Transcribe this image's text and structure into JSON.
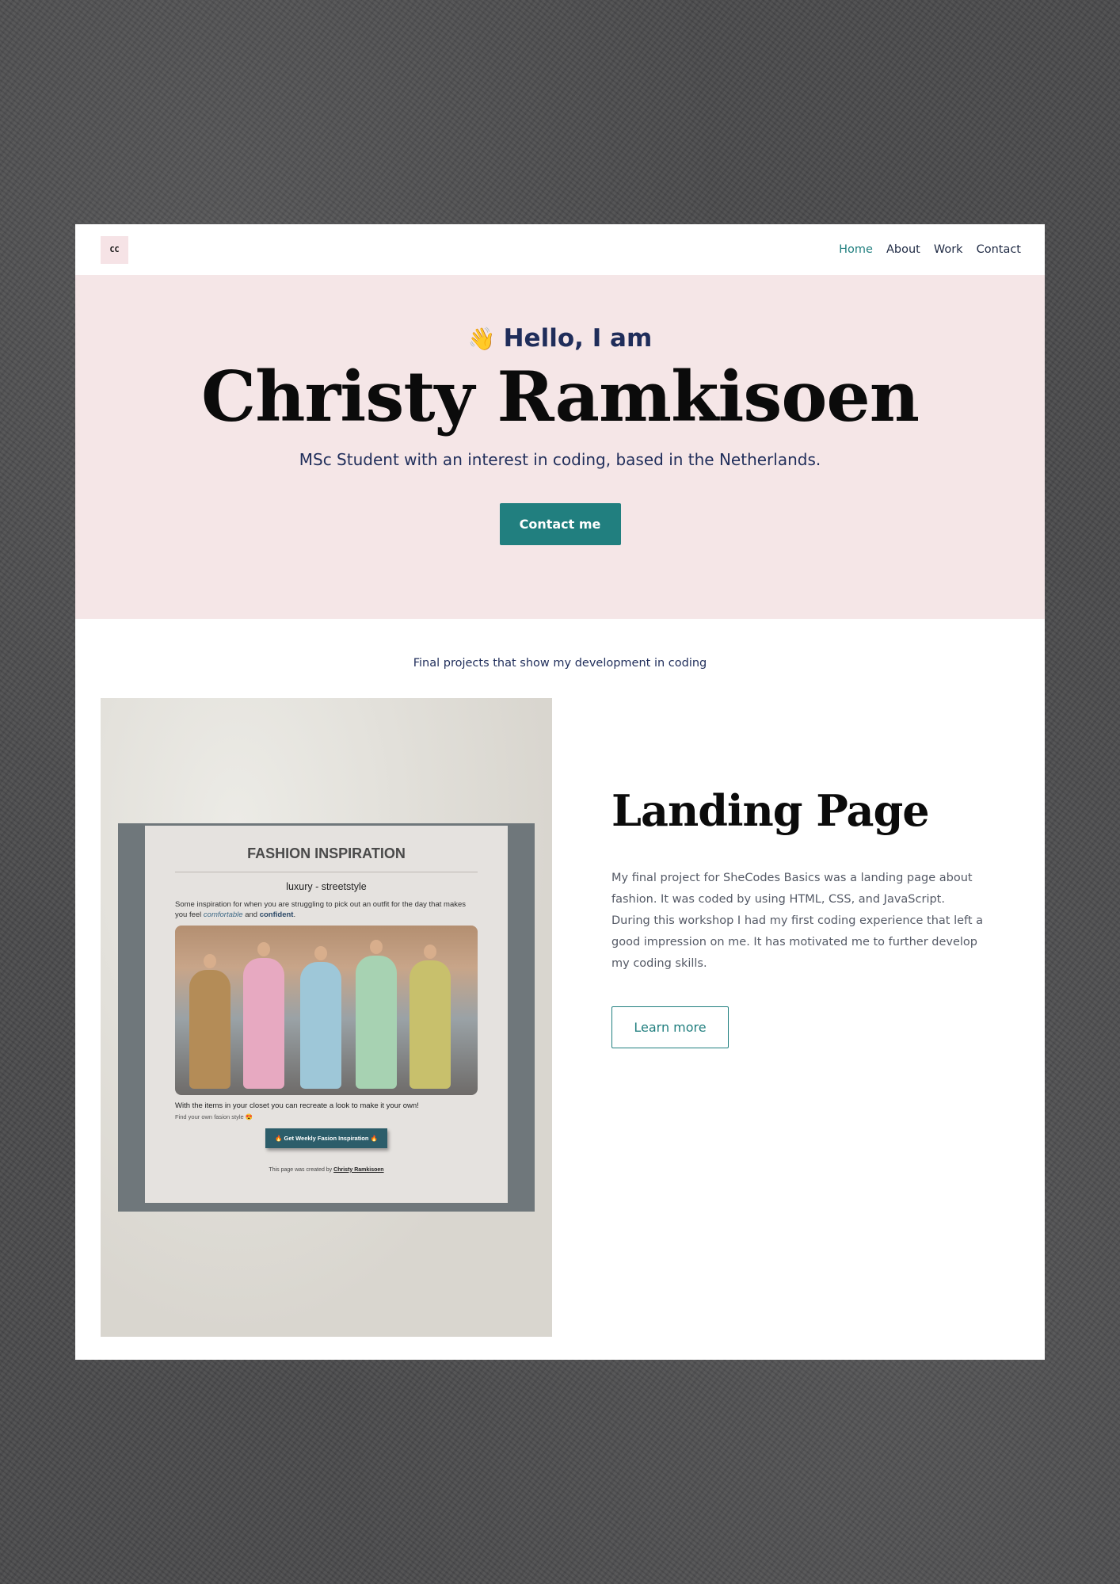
{
  "nav": {
    "logo": "CC",
    "links": [
      {
        "label": "Home",
        "active": true
      },
      {
        "label": "About",
        "active": false
      },
      {
        "label": "Work",
        "active": false
      },
      {
        "label": "Contact",
        "active": false
      }
    ]
  },
  "hero": {
    "wave_emoji": "👋",
    "greeting": "Hello, I am",
    "name": "Christy Ramkisoen",
    "tagline": "MSc Student with an interest in coding, based in the Netherlands.",
    "cta": "Contact me"
  },
  "projects": {
    "intro": "Final projects that show my development in coding",
    "items": [
      {
        "title": "Landing Page",
        "description": "My final project for SheCodes Basics was a landing page about fashion. It was coded by using HTML, CSS, and JavaScript. During this workshop I had my first coding experience that left a good impression on me. It has motivated me to further develop my coding skills.",
        "button": "Learn more",
        "preview": {
          "title": "FASHION INSPIRATION",
          "subtitle": "luxury - streetstyle",
          "text_start": "Some inspiration for when you are struggling to pick out an outfit for the day that makes you feel",
          "text_em": "comfortable",
          "text_and": "and",
          "text_strong": "confident",
          "text_end": ".",
          "footer_line": "With the items in your closet you can recreate a look to make it your own!",
          "footer_small": "Find your own fasion style 😍",
          "button": "🔥 Get Weekly Fasion Inspiration 🔥",
          "credit_prefix": "This page was created by",
          "credit_name": "Christy Ramkisoen"
        }
      }
    ]
  },
  "colors": {
    "accent": "#217f7f",
    "hero_bg": "#f5e6e7",
    "heading_navy": "#1f2d5a"
  }
}
